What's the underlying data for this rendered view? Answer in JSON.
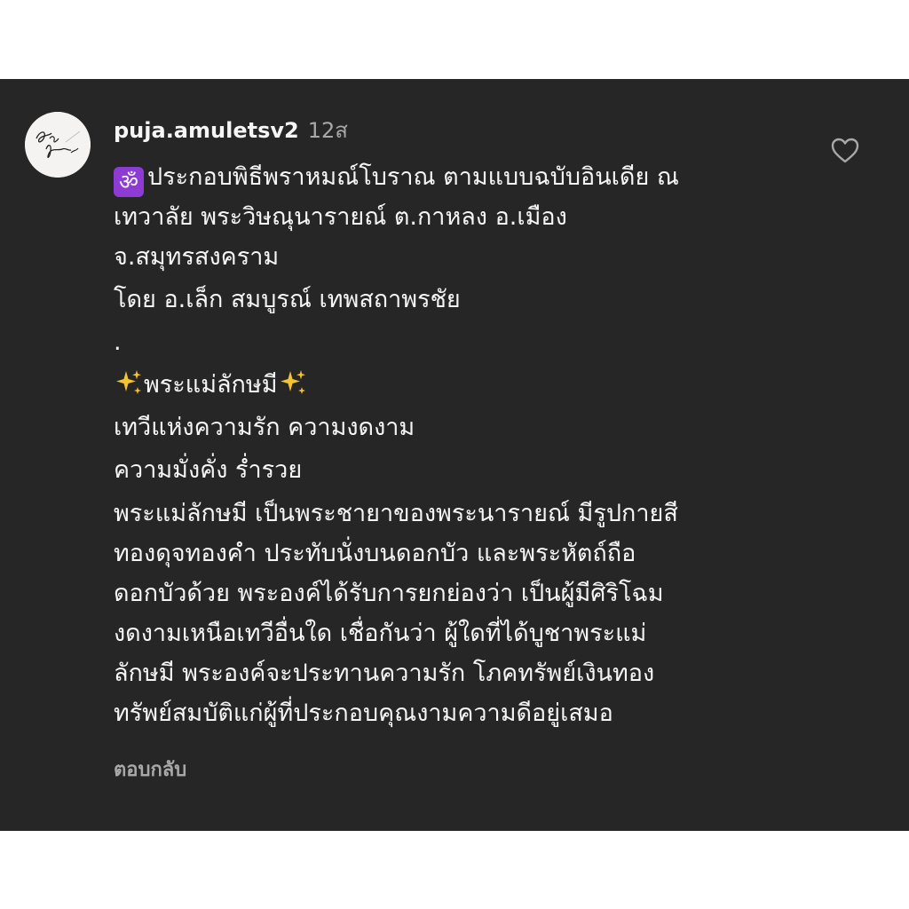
{
  "comment": {
    "username": "puja.amuletsv2",
    "timestamp": "12ส",
    "avatar_icon": "handwritten-signature-avatar",
    "like_icon": "heart-outline-icon",
    "lines": {
      "l1": "ประกอบพิธีพราหมณ์โบราณ ตามแบบฉบับอินเดีย ณ",
      "l2": "เทวาลัย พระวิษณุนารายณ์ ต.กาหลง อ.เมือง",
      "l3": "จ.สมุทรสงคราม",
      "l4": "โดย อ.เล็ก สมบูรณ์ เทพสถาพรชัย",
      "l5": ".",
      "l6": "พระแม่ลักษมี",
      "l7": "เทวีแห่งความรัก ความงดงาม",
      "l8": "ความมั่งคั่ง ร่ำรวย",
      "l9": "พระแม่ลักษมี เป็นพระชายาของพระนารายณ์ มีรูปกายสี",
      "l10": "ทองดุจทองคำ ประทับนั่งบนดอกบัว และพระหัตถ์ถือ",
      "l11": "ดอกบัวด้วย พระองค์ได้รับการยกย่องว่า เป็นผู้มีศิริโฉม",
      "l12": "งดงามเหนือเทวีอื่นใด เชื่อกันว่า ผู้ใดที่ได้บูชาพระแม่",
      "l13": "ลักษมี พระองค์จะประทานความรัก โภคทรัพย์เงินทอง",
      "l14": "ทรัพย์สมบัติแก่ผู้ที่ประกอบคุณงามความดีอยู่เสมอ"
    },
    "om_glyph": "ॐ",
    "reply_label": "ตอบกลับ"
  },
  "colors": {
    "panel_background": "#262626",
    "primary_text": "#f5f5f5",
    "secondary_text": "#a8a8a8",
    "om_badge": "#8e3bd6",
    "sparkle": "#f4c430"
  }
}
